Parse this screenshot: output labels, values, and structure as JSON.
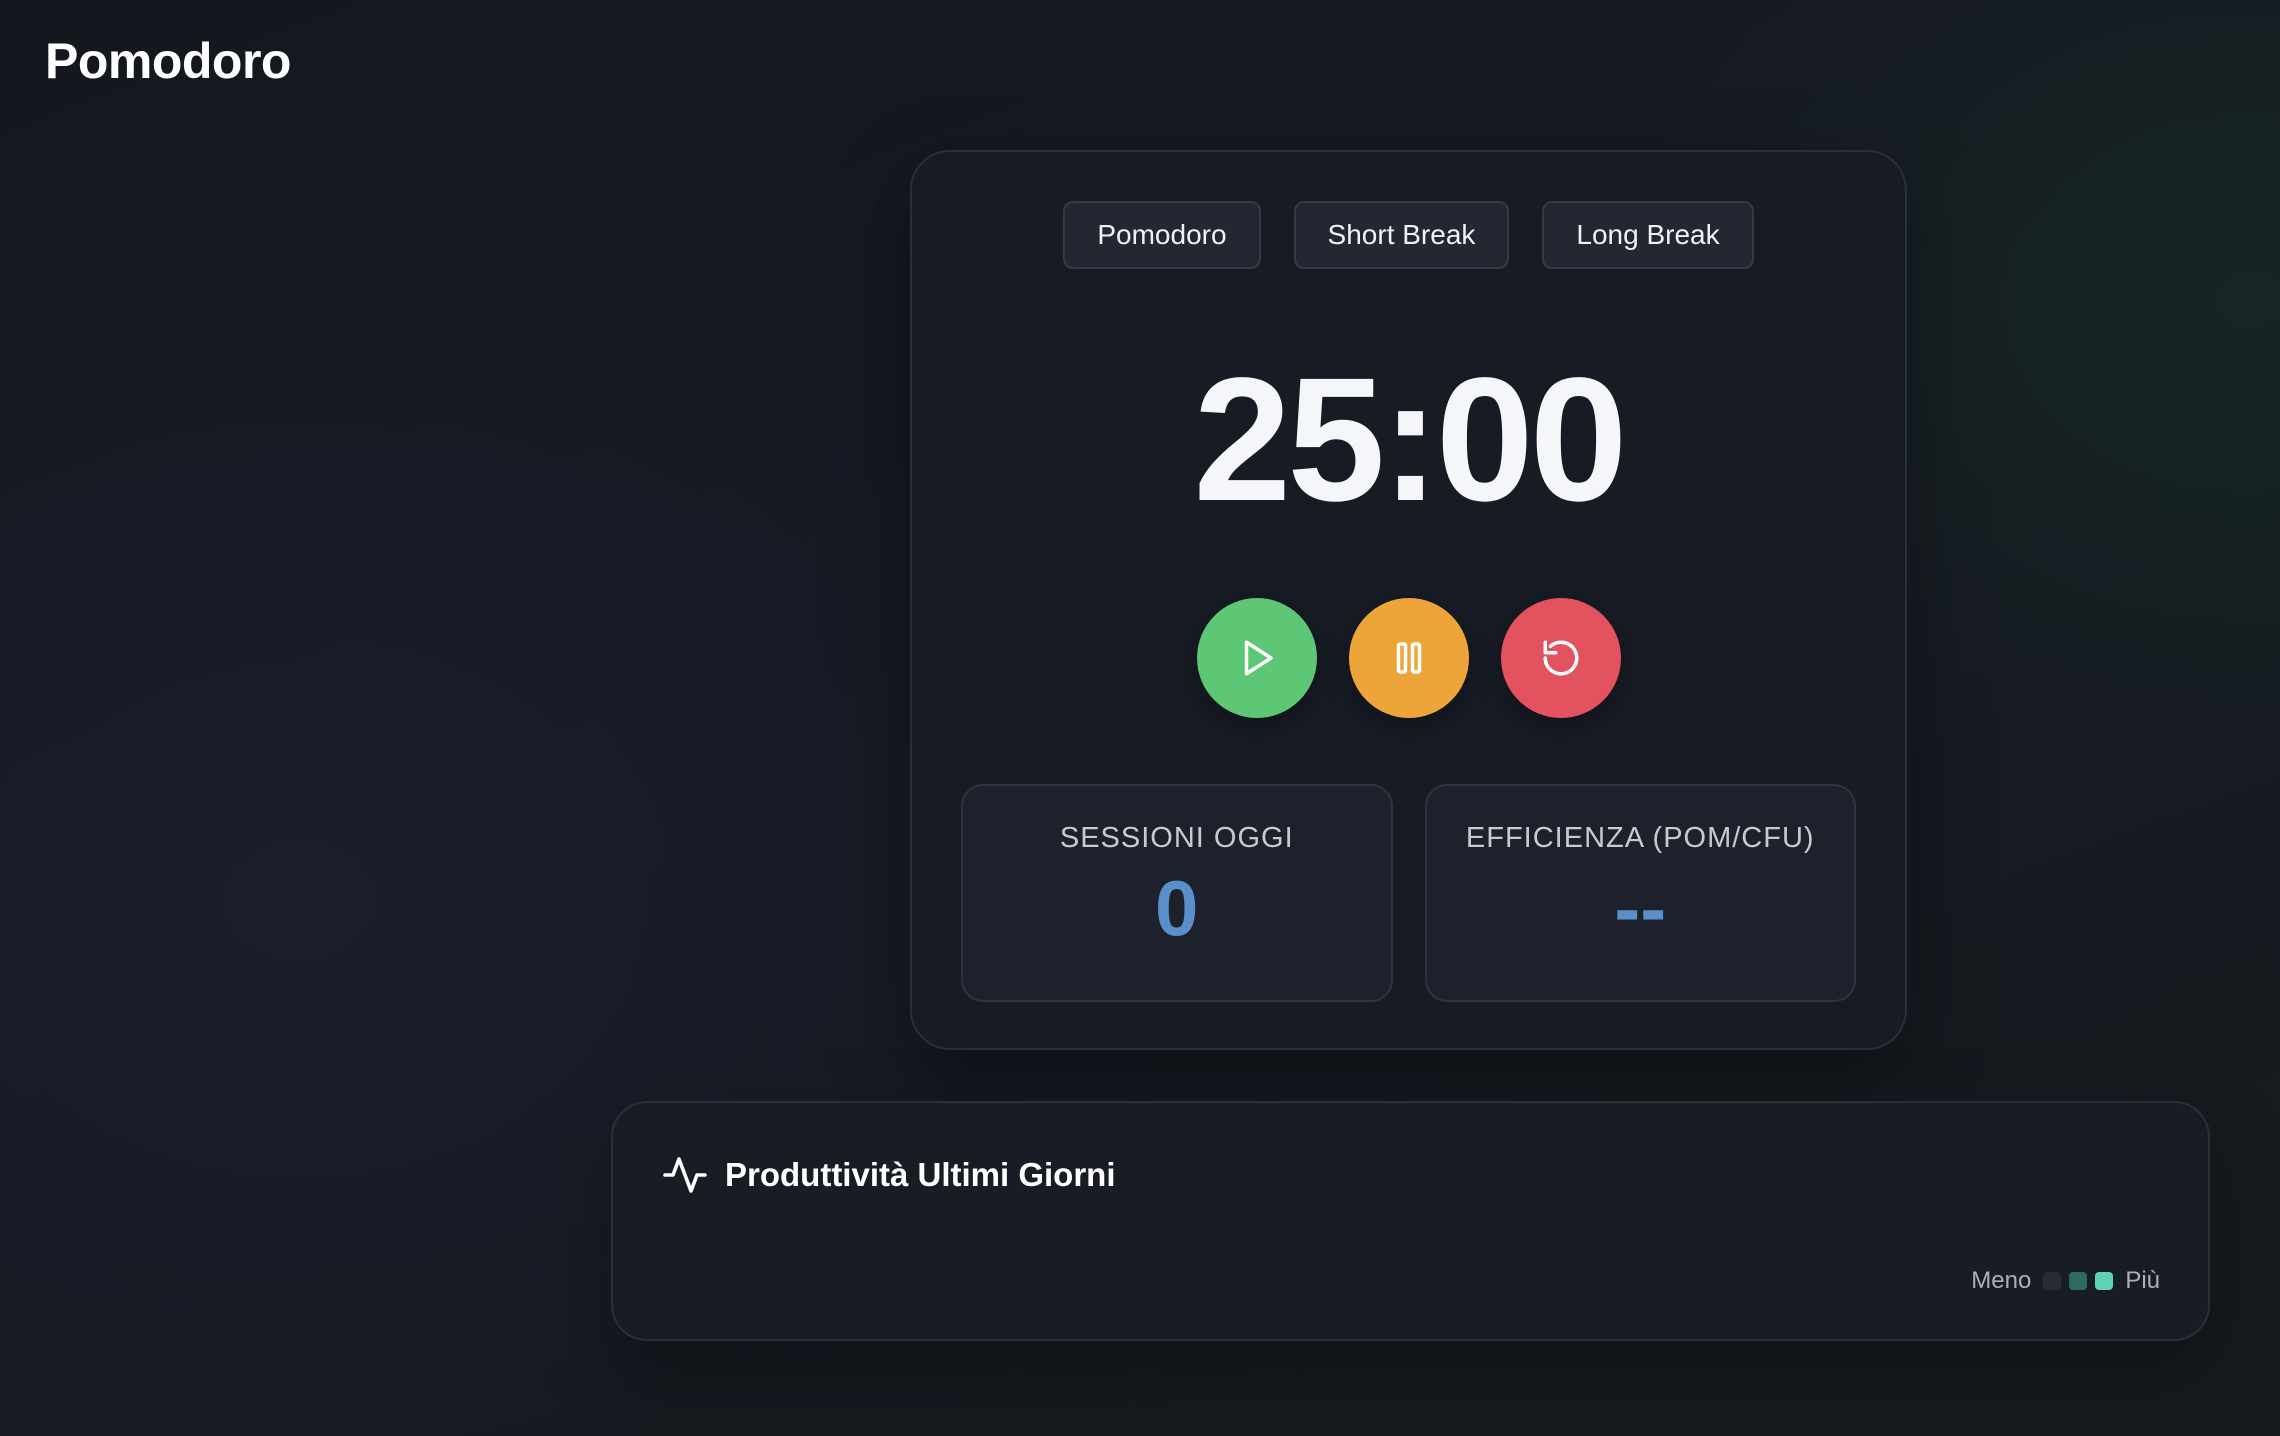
{
  "app": {
    "title": "Pomodoro"
  },
  "timer": {
    "modes": [
      "Pomodoro",
      "Short Break",
      "Long Break"
    ],
    "display": "25:00",
    "controls": {
      "start_icon": "play-icon",
      "pause_icon": "pause-icon",
      "reset_icon": "reset-icon"
    },
    "colors": {
      "start": "#5ec776",
      "pause": "#eda53a",
      "reset": "#e2525f",
      "stat_value": "#5a8fc9"
    }
  },
  "stats": {
    "sessions": {
      "label": "SESSIONI OGGI",
      "value": "0"
    },
    "efficiency": {
      "label": "EFFICIENZA (POM/CFU)",
      "value": "--"
    }
  },
  "productivity": {
    "icon": "activity-icon",
    "title": "Produttività Ultimi Giorni",
    "legend": {
      "less": "Meno",
      "more": "Più",
      "levels": [
        "#262b35",
        "#2f6a5e",
        "#5fd1b4"
      ]
    }
  }
}
